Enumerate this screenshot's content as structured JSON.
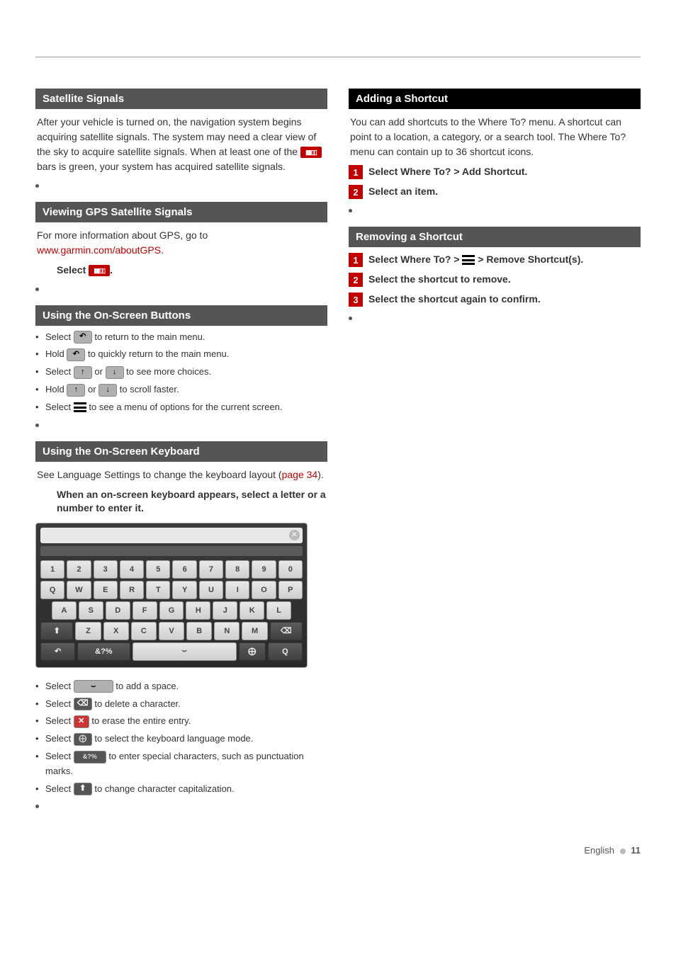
{
  "left": {
    "satSignals": {
      "title": "Satellite Signals",
      "body_a": "After your vehicle is turned on, the navigation system begins acquiring satellite signals. The system may need a clear view of the sky to acquire satellite signals. When at least one of the ",
      "body_b": " bars is green, your system has acquired satellite signals."
    },
    "viewGps": {
      "title": "Viewing GPS Satellite Signals",
      "body_a": "For more information about GPS, go to ",
      "link": "www.garmin.com/aboutGPS",
      "body_b": ".",
      "select_a": "Select ",
      "select_b": "."
    },
    "onscreenButtons": {
      "title": "Using the On-Screen Buttons",
      "b1a": "Select ",
      "b1b": " to return to the main menu.",
      "b2a": "Hold ",
      "b2b": " to quickly return to the main menu.",
      "b3a": "Select ",
      "b3m": " or ",
      "b3b": " to see more choices.",
      "b4a": "Hold ",
      "b4m": " or ",
      "b4b": " to scroll faster.",
      "b5a": "Select ",
      "b5b": " to see a menu of options for the current screen."
    },
    "onscreenKeyboard": {
      "title": "Using the On-Screen Keyboard",
      "body_a": "See Language Settings to change the keyboard layout (",
      "page_ref": "page 34",
      "body_b": ").",
      "instruction": "When an on-screen keyboard appears, select a letter or a number to enter it.",
      "rows": {
        "r1": [
          "1",
          "2",
          "3",
          "4",
          "5",
          "6",
          "7",
          "8",
          "9",
          "0"
        ],
        "r2": [
          "Q",
          "W",
          "E",
          "R",
          "T",
          "Y",
          "U",
          "I",
          "O",
          "P"
        ],
        "r3": [
          "A",
          "S",
          "D",
          "F",
          "G",
          "H",
          "J",
          "K",
          "L"
        ],
        "r4_shift": "⬆",
        "r4": [
          "Z",
          "X",
          "C",
          "V",
          "B",
          "N",
          "M"
        ],
        "r4_bksp": "⌫",
        "r5_back": "↶",
        "r5_sym": "&?%",
        "r5_globe": "⨁",
        "r5_search": "Q"
      },
      "k1a": "Select ",
      "k1b": " to add a space.",
      "k2a": "Select ",
      "k2b": " to delete a character.",
      "k3a": "Select ",
      "k3b": " to erase the entire entry.",
      "k4a": "Select ",
      "k4b": " to select the keyboard language mode.",
      "k5a": "Select ",
      "k5b": " to enter special characters, such as punctuation marks.",
      "k6a": "Select ",
      "k6b": " to change character capitalization."
    }
  },
  "right": {
    "addShortcut": {
      "title": "Adding a Shortcut",
      "body": "You can add shortcuts to the Where To? menu. A shortcut can point to a location, a category, or a search tool. The Where To? menu can contain up to 36 shortcut icons.",
      "s1": "Select Where To? > Add Shortcut.",
      "s2": "Select an item."
    },
    "removeShortcut": {
      "title": "Removing a Shortcut",
      "s1a": "Select Where To? > ",
      "s1b": " > Remove Shortcut(s).",
      "s2": "Select the shortcut to remove.",
      "s3": "Select the shortcut again to confirm."
    }
  },
  "footer": {
    "lang": "English",
    "page": "11"
  }
}
